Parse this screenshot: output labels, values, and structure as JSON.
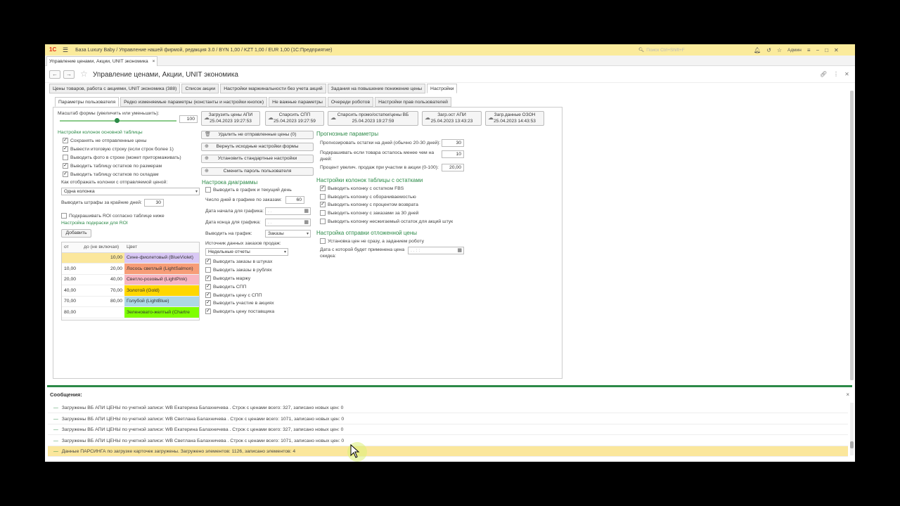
{
  "window": {
    "title": "База Luxury Baby / Управление нашей фирмой, редакция 3.0 / BYN 1,00 / KZT 1,00 / EUR 1,00  (1С:Предприятие)",
    "logo": "1С",
    "search_placeholder": "Поиск Ctrl+Shift+F",
    "user": "Админ"
  },
  "window_tab": {
    "label": "Управление ценами, Акции, UNIT экономика",
    "close": "×"
  },
  "form": {
    "title": "Управление ценами, Акции, UNIT экономика",
    "back": "←",
    "forward": "→"
  },
  "main_tabs": [
    {
      "label": "Цены товаров, работа с акциями, UNIT экономика (388)"
    },
    {
      "label": "Список акции"
    },
    {
      "label": "Настройки маржинальности без учета акций"
    },
    {
      "label": "Задания на повышение понижение цены"
    },
    {
      "label": "Настройки"
    }
  ],
  "sub_tabs": [
    {
      "label": "Параметры пользователя"
    },
    {
      "label": "Редко изменяемые параметры (константы и настройки кнопок)"
    },
    {
      "label": "Не важные параметры"
    },
    {
      "label": "Очереди роботов"
    },
    {
      "label": "Настройки прав пользователей"
    }
  ],
  "scale": {
    "label": "Масштаб формы (увеличить или уменьшить):",
    "value": "100",
    "level": 0.5
  },
  "cloud_buttons": [
    {
      "line1": "Загрузить цены АПИ",
      "line2": "25.04.2023 19:27:53"
    },
    {
      "line1": "Спарсить СПП",
      "line2": "25.04.2023 19:27:59"
    },
    {
      "line1": "Спарсить промо/остатки/цены ВБ",
      "line2": "25.04.2023 19:27:59"
    },
    {
      "line1": "Загр.ост АПИ",
      "line2": "25.04.2023 13:43:23"
    },
    {
      "line1": "Загр.данные ОЗОН",
      "line2": "25.04.2023 14:43:53"
    }
  ],
  "left": {
    "section_title": "Настройки колонок основной таблицы",
    "checkboxes": [
      {
        "label": "Сохранять не отправленные цены",
        "checked": true
      },
      {
        "label": "Вывести итоговую строку (если строк более 1)",
        "checked": true
      },
      {
        "label": "Выводить фото в строке (может притормаживать)",
        "checked": false
      },
      {
        "label": "Выводить таблицу остатков по размерам",
        "checked": true
      },
      {
        "label": "Выводить таблицу остатков по складам",
        "checked": true
      }
    ],
    "display_label": "Как отображать колонки с отправляемой ценой:",
    "display_value": "Одна колонка",
    "fines_label": "Выводить штрафы за крайние дней:",
    "fines_value": "30",
    "roi_checkbox": {
      "label": "Подкрашивать ROI согласно таблице ниже",
      "checked": false
    },
    "roi_title": "Настройка подкраски для ROI",
    "add_button": "Добавить",
    "roi_headers": [
      "от",
      "до (не включая)",
      "Цвет"
    ],
    "roi_rows": [
      {
        "from": "",
        "to": "10,00",
        "color": "Сине-фиолетовый (BlueViolet)",
        "hex": "#d9c8f5"
      },
      {
        "from": "10,00",
        "to": "20,00",
        "color": "Лосось светлый (LightSalmon)",
        "hex": "#f79d78"
      },
      {
        "from": "20,00",
        "to": "40,00",
        "color": "Светло-розовый (LightPink)",
        "hex": "#f8b6c1"
      },
      {
        "from": "40,00",
        "to": "70,00",
        "color": "Золотой (Gold)",
        "hex": "#ffd700"
      },
      {
        "from": "70,00",
        "to": "80,00",
        "color": "Голубой (LightBlue)",
        "hex": "#add8e6"
      },
      {
        "from": "80,00",
        "to": "",
        "color": "Зеленовато-желтый (Chartre",
        "hex": "#7fff00"
      }
    ]
  },
  "middle": {
    "buttons": [
      {
        "label": "Удалить не отправленные цены (0)",
        "icon": "trash-icon"
      },
      {
        "label": "Вернуть исходные настройки формы",
        "icon": "restore-icon"
      },
      {
        "label": "Установить стандартные настройки",
        "icon": "settings-icon"
      },
      {
        "label": "Сменить пароль пользователя",
        "icon": "key-icon"
      }
    ],
    "chart_title": "Настрока диаграммы",
    "chart_today": {
      "label": "Выводить в график и текущий день",
      "checked": false
    },
    "days_label": "Число дней в графике по заказам:",
    "days_value": "60",
    "start_label": "Дата начала для графика:",
    "end_label": "Дата конца для графика:",
    "date_placeholder": ". .",
    "output_label": "Выводить на график:",
    "output_value": "Заказы",
    "source_label": "Источник данных заказов продаж:",
    "source_value": "Недельные отчеты",
    "checkboxes": [
      {
        "label": "Выводить заказы в штуках",
        "checked": true
      },
      {
        "label": "Выводить заказы в рублях",
        "checked": false
      },
      {
        "label": "Выводить маржу",
        "checked": true
      },
      {
        "label": "Выводить СПП",
        "checked": true
      },
      {
        "label": "Выводить цену с СПП",
        "checked": true
      },
      {
        "label": "Выводить участие в акциях",
        "checked": true
      },
      {
        "label": "Выводить цену поставщика",
        "checked": true
      }
    ]
  },
  "right": {
    "forecast_title": "Прогнозные параметры",
    "forecast_fields": [
      {
        "label": "Прогнозировать остатки на дней (обычно 20-30 дней):",
        "value": "30"
      },
      {
        "label": "Подкрашивать если товара осталось менее чем на дней:",
        "value": "10"
      },
      {
        "label": "Процент увелич. продаж при участии в акции (0-100):",
        "value": "20,00"
      }
    ],
    "stock_title": "Настройки колонок таблицы с остатками",
    "stock_checkboxes": [
      {
        "label": "Выводить колонку с остатком FBS",
        "checked": true
      },
      {
        "label": "Выводить колонку с оборачиваемостью",
        "checked": false
      },
      {
        "label": "Выводить колонку с процентом возврата",
        "checked": true
      },
      {
        "label": "Выводить колонку с заказами за 30 дней",
        "checked": false
      },
      {
        "label": "Выводить колонку несжигаемый остаток для акций штук",
        "checked": false
      }
    ],
    "deferred_title": "Настройка отправки отложенной цены",
    "deferred_checkbox": {
      "label": "Установка цен не сразу, а заданием роботу",
      "checked": false
    },
    "deferred_date_label": "Дата с которой будет применена цена скидка:",
    "deferred_date_placeholder": ". .    : :"
  },
  "messages": {
    "title": "Сообщения:",
    "close": "×",
    "items": [
      {
        "text": "Загружены ВБ АПИ ЦЕНЫ по учетной записи: WB Екатерина Балахничева . Строк с ценами всего: 327, записано новых цен: 0",
        "highlight": false
      },
      {
        "text": "Загружены ВБ АПИ ЦЕНЫ по учетной записи: WB Светлана Балахничева . Строк с ценами всего: 1071, записано новых цен: 0",
        "highlight": false
      },
      {
        "text": "Загружены ВБ АПИ ЦЕНЫ по учетной записи: WB Екатерина Балахничева . Строк с ценами всего: 327, записано новых цен: 0",
        "highlight": false
      },
      {
        "text": "Загружены ВБ АПИ ЦЕНЫ по учетной записи: WB Светлана Балахничева . Строк с ценами всего: 1071, записано новых цен: 0",
        "highlight": false
      },
      {
        "text": "Данные ПАРСИНГА по загрузке карточек загружены. Загружено элементов: 1126, записано элементов: 4",
        "highlight": true
      }
    ]
  },
  "colors": {
    "accent_green": "#2c8a48",
    "titlebar": "#fbeb9c",
    "highlight": "#fbe79c"
  }
}
